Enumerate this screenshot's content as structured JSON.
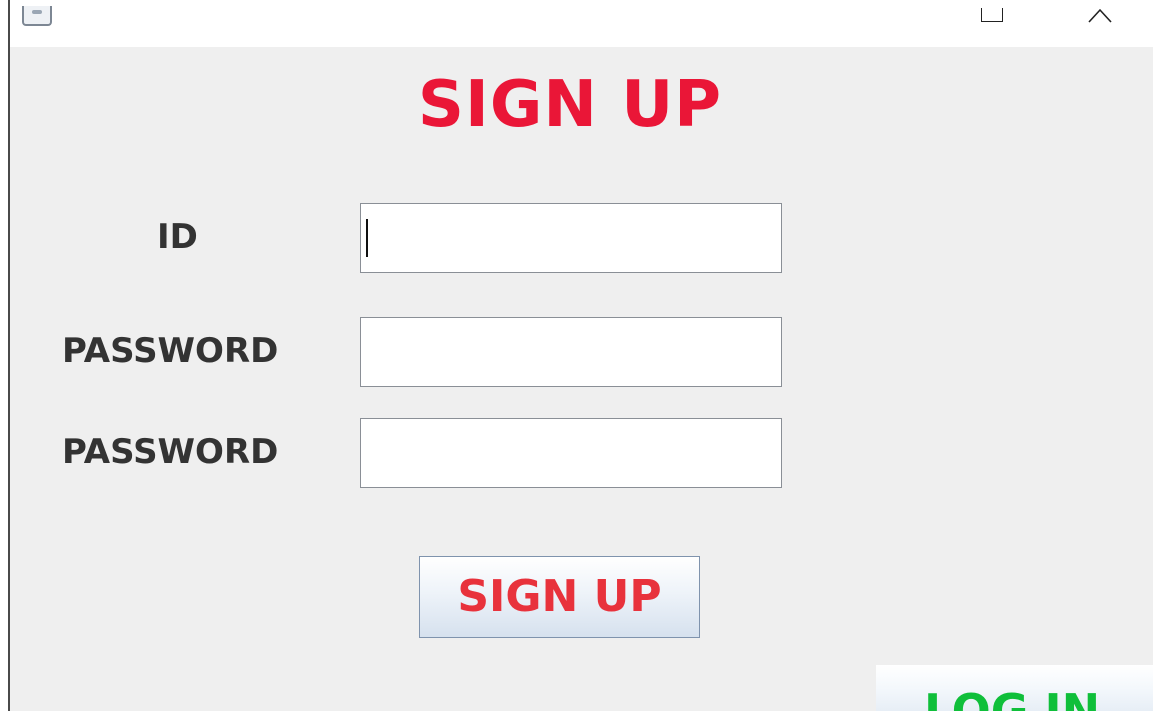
{
  "window": {
    "icon": "java-app-icon",
    "controls": [
      "maximize-icon",
      "collapse-icon"
    ]
  },
  "form": {
    "title": "SIGN UP",
    "title_color": "#ea1637",
    "fields": {
      "id": {
        "label": "ID",
        "value": ""
      },
      "password": {
        "label": "PASSWORD",
        "value": ""
      },
      "password_confirm": {
        "label": "PASSWORD",
        "value": ""
      }
    },
    "signup_button": {
      "label": "SIGN UP",
      "color": "#e8323c"
    },
    "login_button": {
      "label": "LOG IN",
      "color": "#0fbf3a"
    }
  }
}
